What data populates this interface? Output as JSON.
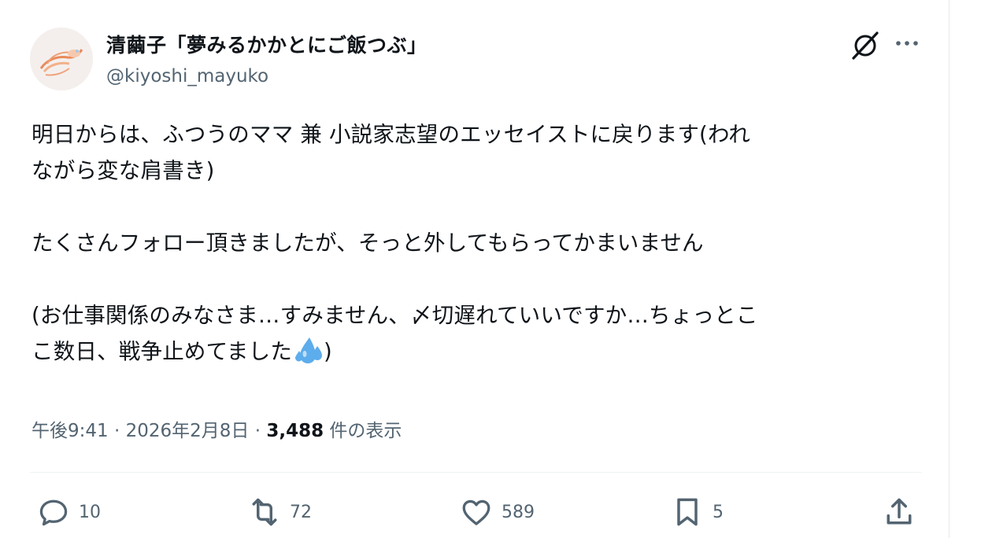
{
  "author": {
    "display_name": "清繭子「夢みるかかとにご飯つぶ」",
    "handle": "@kiyoshi_mayuko"
  },
  "post": {
    "line1": "明日からは、ふつうのママ 兼 小説家志望のエッセイストに戻ります(われ",
    "line2": "ながら変な肩書き)",
    "line3": "たくさんフォロー頂きましたが、そっと外してもらってかまいません",
    "line4": "(お仕事関係のみなさま…すみません、〆切遅れていいですか…ちょっとこ",
    "line5_text": "こ数日、戦争止めてました",
    "line5_end": ")",
    "emoji": "sweat-droplets-emoji"
  },
  "meta": {
    "time": "午後9:41",
    "sep1": " · ",
    "date": "2026年2月8日",
    "sep2": " · ",
    "views": "3,488",
    "views_label": " 件の表示"
  },
  "actions": {
    "replies": "10",
    "reposts": "72",
    "likes": "589",
    "bookmarks": "5"
  },
  "icons": {
    "grok": "grok-icon",
    "more": "more-icon",
    "reply": "reply-icon",
    "repost": "repost-icon",
    "like": "heart-icon",
    "bookmark": "bookmark-icon",
    "share": "share-icon"
  },
  "colors": {
    "text": "#0f1419",
    "secondary": "#536471",
    "divider": "#eff3f4",
    "emoji_blue": "#5dadec"
  }
}
